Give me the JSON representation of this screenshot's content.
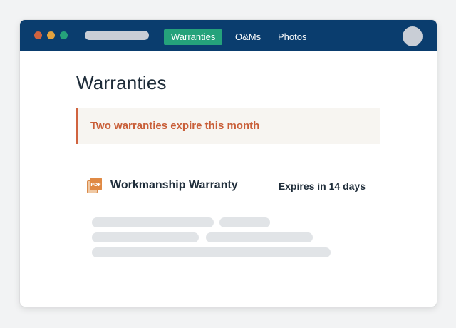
{
  "nav": {
    "tabs": [
      {
        "label": "Warranties",
        "active": true
      },
      {
        "label": "O&Ms",
        "active": false
      },
      {
        "label": "Photos",
        "active": false
      }
    ]
  },
  "main": {
    "title": "Warranties",
    "alert": {
      "text": "Two warranties expire this month",
      "color": "#d0633f"
    },
    "card": {
      "icon": "pdf-file-icon",
      "icon_label": "PDF",
      "title": "Workmanship Warranty",
      "expiry": "Expires in 14 days"
    }
  },
  "colors": {
    "titlebar": "#0a3d6e",
    "accent": "#25a27b",
    "warning": "#d0633f",
    "text": "#1f2d3a"
  }
}
